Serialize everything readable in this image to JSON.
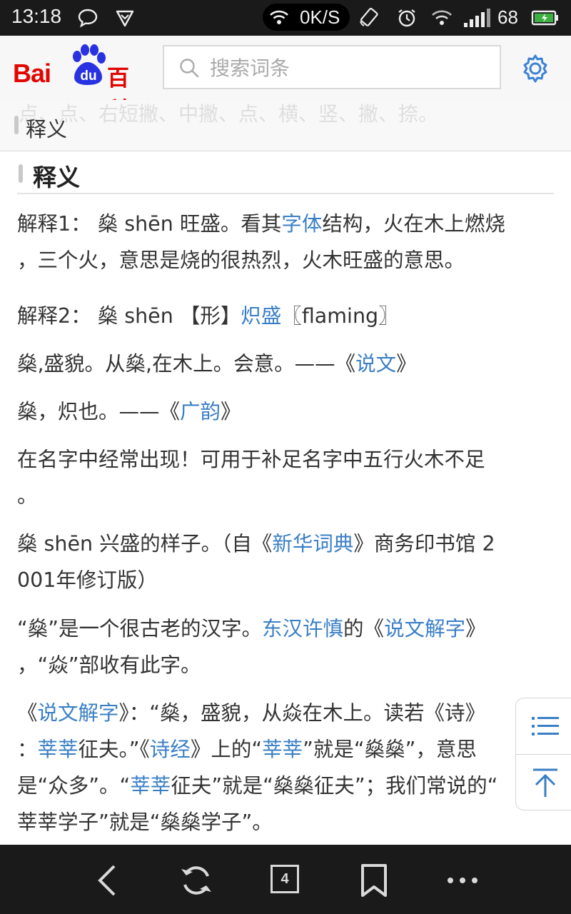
{
  "status_bar": {
    "time": "13:18",
    "net_speed": "0K/S",
    "battery": "68",
    "icons": [
      "chat-bubble-icon",
      "shield-check-icon",
      "hotspot-icon",
      "rotate-lock-icon",
      "alarm-icon",
      "wifi-icon",
      "signal-icon",
      "battery-icon"
    ]
  },
  "header": {
    "logo_bai": "Bai",
    "logo_du": "du",
    "logo_baike": "百科",
    "search_placeholder": "搜索词条",
    "colors": {
      "brand_red": "#e10601",
      "brand_blue": "#2932e1",
      "settings_blue": "#3b82d6"
    }
  },
  "sticky_nav": {
    "ghost_text": "点、点、右短撇、中撇、点、横、竖、撇、捺。",
    "title": "释义"
  },
  "content": {
    "section_title": "释义",
    "link_color": "#3a7fc6",
    "paragraphs": [
      {
        "lines": [
          [
            {
              "t": "解释1： 燊 shēn 旺盛。看其"
            },
            {
              "t": "字体",
              "link": true
            },
            {
              "t": "结构，火在木上燃烧"
            }
          ],
          [
            {
              "t": "，三个火，意思是烧的很热烈，火木旺盛的意思。"
            }
          ]
        ]
      },
      {
        "lines": [
          [
            {
              "t": "解释2： 燊 shēn 【形】"
            },
            {
              "t": "炽盛",
              "link": true
            },
            {
              "t": "〖flaming〗"
            }
          ]
        ]
      },
      {
        "lines": [
          [
            {
              "t": "燊,盛貌。从燊,在木上。会意。——《"
            },
            {
              "t": "说文",
              "link": true
            },
            {
              "t": "》"
            }
          ]
        ]
      },
      {
        "lines": [
          [
            {
              "t": "燊，炽也。——《"
            },
            {
              "t": "广韵",
              "link": true
            },
            {
              "t": "》"
            }
          ]
        ]
      },
      {
        "lines": [
          [
            {
              "t": "在名字中经常出现！可用于补足名字中五行火木不足"
            }
          ],
          [
            {
              "t": "。"
            }
          ]
        ]
      },
      {
        "lines": [
          [
            {
              "t": "燊 shēn 兴盛的样子。（自《"
            },
            {
              "t": "新华词典",
              "link": true
            },
            {
              "t": "》商务印书馆 2"
            }
          ],
          [
            {
              "t": "001年修订版）"
            }
          ]
        ]
      },
      {
        "lines": [
          [
            {
              "t": "“燊”是一个很古老的汉字。"
            },
            {
              "t": "东汉许慎",
              "link": true
            },
            {
              "t": "的《"
            },
            {
              "t": "说文解字",
              "link": true
            },
            {
              "t": "》"
            }
          ],
          [
            {
              "t": "，“焱”部收有此字。"
            }
          ]
        ]
      },
      {
        "lines": [
          [
            {
              "t": "《"
            },
            {
              "t": "说文解字",
              "link": true
            },
            {
              "t": "》：“燊，盛貌，从焱在木上。读若《诗》"
            }
          ],
          [
            {
              "t": "："
            },
            {
              "t": "莘莘",
              "link": true
            },
            {
              "t": "征夫。”《"
            },
            {
              "t": "诗经",
              "link": true
            },
            {
              "t": "》上的“"
            },
            {
              "t": "莘莘",
              "link": true
            },
            {
              "t": "”就是“燊燊”，意思"
            }
          ],
          [
            {
              "t": "是“众多”。“"
            },
            {
              "t": "莘莘",
              "link": true
            },
            {
              "t": "征夫”就是“燊燊征夫”；我们常说的“"
            }
          ],
          [
            {
              "t": "莘莘学子”就是“燊燊学子”。"
            }
          ]
        ]
      }
    ]
  },
  "side_panel": {
    "buttons": [
      "toc-list-icon",
      "back-to-top-icon"
    ]
  },
  "bottom_bar": {
    "tab_count": "4",
    "buttons": [
      "back-arrow-icon",
      "refresh-icon",
      "tabs-icon",
      "bookmark-icon",
      "more-icon"
    ]
  }
}
